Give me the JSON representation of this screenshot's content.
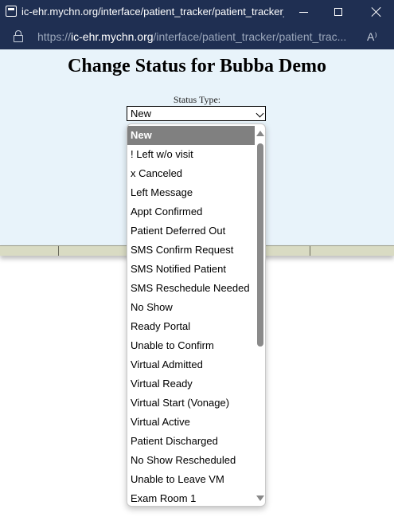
{
  "window": {
    "title": "ic-ehr.mychn.org/interface/patient_tracker/patient_tracker_st...",
    "minimize_label": "—",
    "maximize_label": "☐",
    "close_label": "✕"
  },
  "addressbar": {
    "scheme": "https://",
    "host": "ic-ehr.mychn.org",
    "path": "/interface/patient_tracker/patient_trac...",
    "read_aloud_glyph": "A⁾"
  },
  "page": {
    "heading": "Change Status for Bubba Demo",
    "status_label": "Status Type:",
    "selected_value": "New"
  },
  "dropdown": {
    "options": [
      "New",
      "! Left w/o visit",
      "x Canceled",
      "Left Message",
      "Appt Confirmed",
      "Patient Deferred Out",
      "SMS Confirm Request",
      "SMS Notified Patient",
      "SMS Reschedule Needed",
      "No Show",
      "Ready Portal",
      "Unable to Confirm",
      "Virtual Admitted",
      "Virtual Ready",
      "Virtual Start (Vonage)",
      "Virtual Active",
      "Patient Discharged",
      "No Show Rescheduled",
      "Unable to Leave VM",
      "Exam Room 1"
    ],
    "selected_index": 0
  },
  "colors": {
    "chrome_bg": "#1f2f52",
    "page_bg": "#e8f3fa",
    "selected_option_bg": "#808080"
  },
  "icons": [
    "window-icon",
    "lock-icon",
    "read-aloud-icon",
    "chevron-down-icon",
    "scroll-up-icon",
    "scroll-down-icon"
  ]
}
